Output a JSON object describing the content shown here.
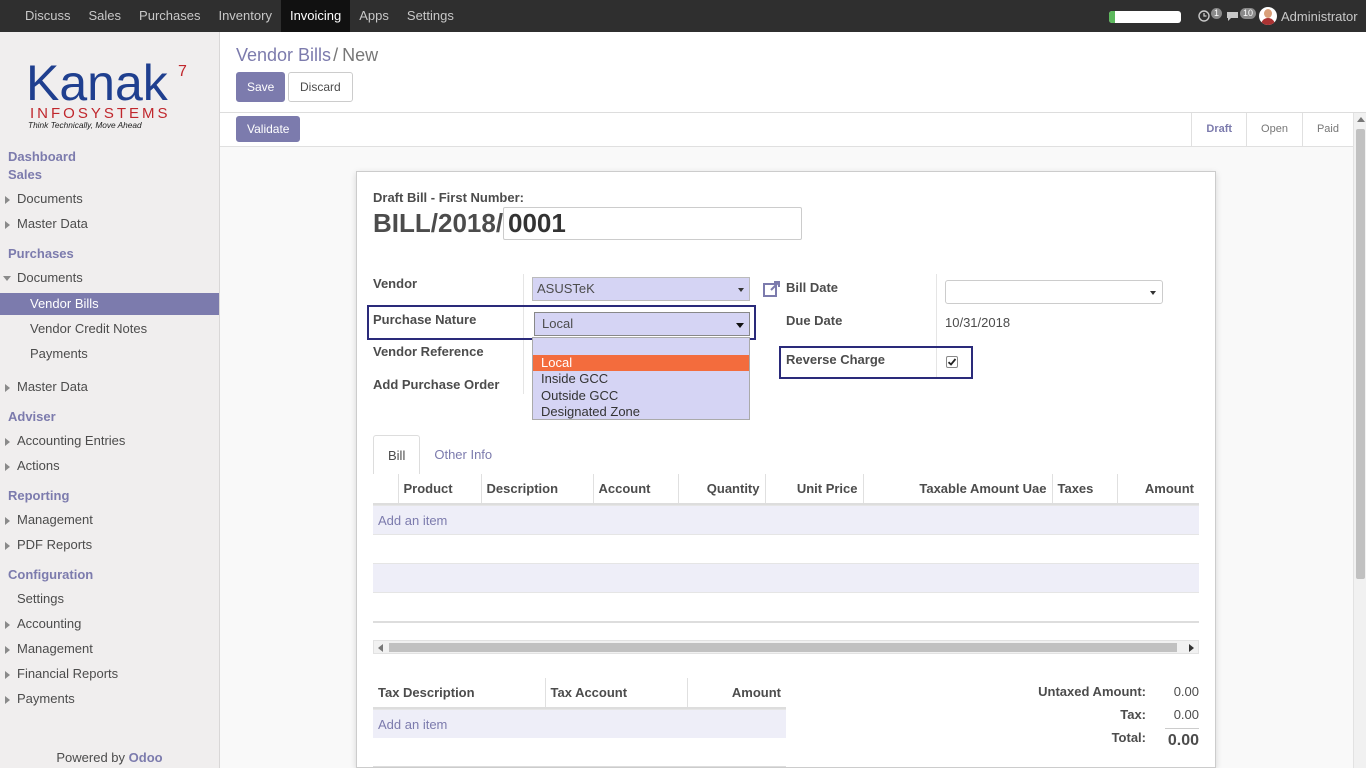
{
  "topbar": {
    "menu": [
      "Discuss",
      "Sales",
      "Purchases",
      "Inventory",
      "Invoicing",
      "Apps",
      "Settings"
    ],
    "active": "Invoicing",
    "progress_fraction": 0.08,
    "progress_color": "#5cb85c",
    "activity_badge": "1",
    "messages_badge": "10",
    "user": "Administrator"
  },
  "sidebar": {
    "logo": {
      "brand": "Kanak",
      "sup": "7",
      "sub": "INFOSYSTEMS",
      "tagline": "Think Technically, Move Ahead"
    },
    "items": [
      {
        "label": "Dashboard",
        "kind": "section"
      },
      {
        "label": "Sales",
        "kind": "section"
      },
      {
        "label": "Documents",
        "kind": "l1",
        "caret": "right"
      },
      {
        "label": "Master Data",
        "kind": "l1",
        "caret": "right"
      },
      {
        "label": "Purchases",
        "kind": "section"
      },
      {
        "label": "Documents",
        "kind": "l1",
        "caret": "down"
      },
      {
        "label": "Vendor Bills",
        "kind": "l2",
        "active": true
      },
      {
        "label": "Vendor Credit Notes",
        "kind": "l2"
      },
      {
        "label": "Payments",
        "kind": "l2"
      },
      {
        "label": "Master Data",
        "kind": "l1",
        "caret": "right"
      },
      {
        "label": "Adviser",
        "kind": "section"
      },
      {
        "label": "Accounting Entries",
        "kind": "l1",
        "caret": "right"
      },
      {
        "label": "Actions",
        "kind": "l1",
        "caret": "right"
      },
      {
        "label": "Reporting",
        "kind": "section"
      },
      {
        "label": "Management",
        "kind": "l1",
        "caret": "right"
      },
      {
        "label": "PDF Reports",
        "kind": "l1",
        "caret": "right"
      },
      {
        "label": "Configuration",
        "kind": "section"
      },
      {
        "label": "Settings",
        "kind": "l1"
      },
      {
        "label": "Accounting",
        "kind": "l1",
        "caret": "right"
      },
      {
        "label": "Management",
        "kind": "l1",
        "caret": "right"
      },
      {
        "label": "Financial Reports",
        "kind": "l1",
        "caret": "right"
      },
      {
        "label": "Payments",
        "kind": "l1",
        "caret": "right"
      }
    ],
    "powered_prefix": "Powered by",
    "powered_brand": "Odoo"
  },
  "control_panel": {
    "breadcrumb_parent": "Vendor Bills",
    "breadcrumb_sep": "/",
    "breadcrumb_current": "New",
    "save": "Save",
    "discard": "Discard"
  },
  "header": {
    "validate": "Validate",
    "statuses": [
      "Draft",
      "Open",
      "Paid"
    ],
    "current_status": "Draft"
  },
  "form": {
    "title_label": "Draft Bill",
    "title_suffix": " - First Number:",
    "number_prefix": "BILL/2018/",
    "number_value": "0001",
    "vendor_label": "Vendor",
    "vendor_value": "ASUSTeK",
    "purchase_nature_label": "Purchase Nature",
    "purchase_nature_value": "Local",
    "purchase_nature_options": [
      "",
      "Local",
      "Inside GCC",
      "Outside GCC",
      "Designated Zone"
    ],
    "vendor_reference_label": "Vendor Reference",
    "add_po_label": "Add Purchase Order",
    "bill_date_label": "Bill Date",
    "bill_date_value": "",
    "due_date_label": "Due Date",
    "due_date_value": "10/31/2018",
    "reverse_charge_label": "Reverse Charge",
    "reverse_charge_checked": true
  },
  "tabs": [
    "Bill",
    "Other Info"
  ],
  "lines_table": {
    "columns": [
      "",
      "Product",
      "Description",
      "Account",
      "Quantity",
      "Unit Price",
      "Taxable Amount Uae",
      "Taxes",
      "Amount"
    ],
    "add_item": "Add an item"
  },
  "tax_table": {
    "columns": [
      "Tax Description",
      "Tax Account",
      "Amount"
    ],
    "add_item": "Add an item"
  },
  "totals": {
    "untaxed_label": "Untaxed Amount:",
    "untaxed_value": "0.00",
    "tax_label": "Tax:",
    "tax_value": "0.00",
    "total_label": "Total:",
    "total_value": "0.00"
  },
  "colors": {
    "brand": "#7c7bad",
    "highlight_option": "#f36c3d",
    "field_bg": "#d5d4f4",
    "annotation_box": "#2a2a7a"
  }
}
